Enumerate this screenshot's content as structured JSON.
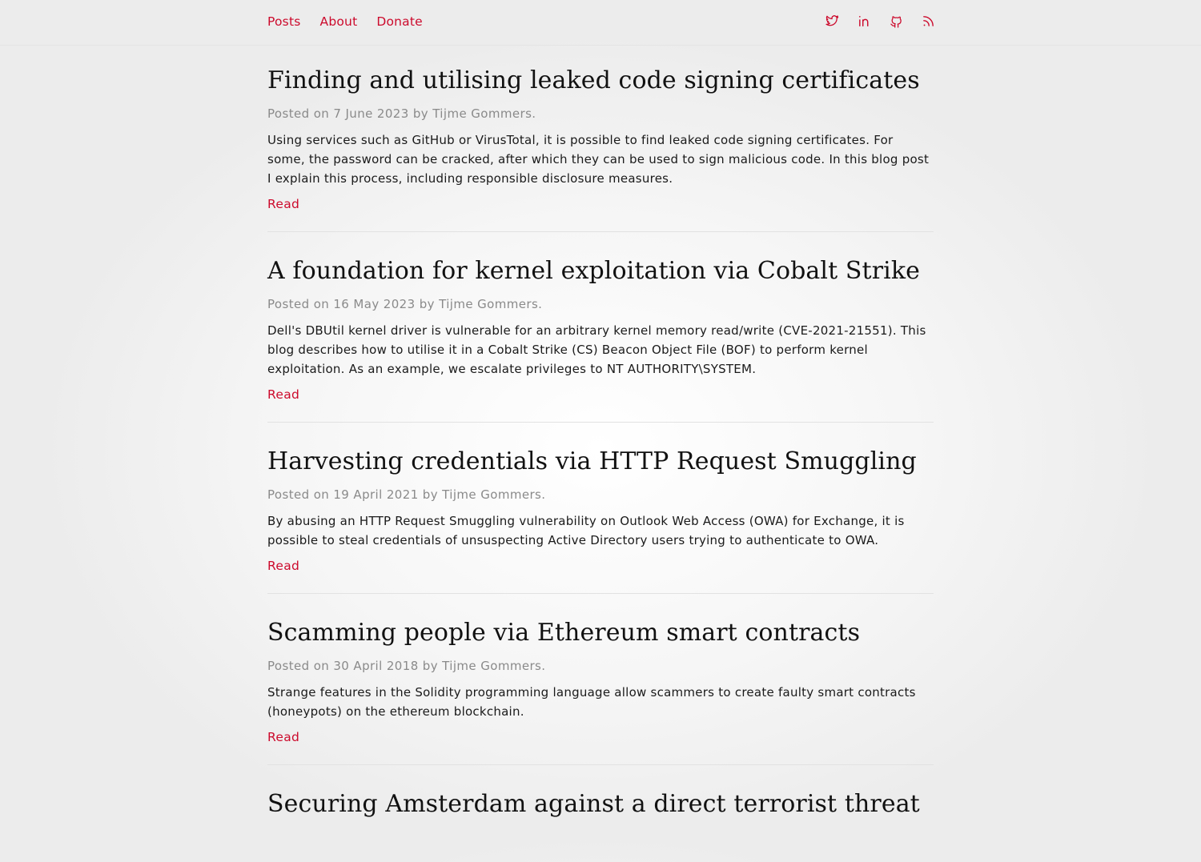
{
  "nav": {
    "items": [
      "Posts",
      "About",
      "Donate"
    ]
  },
  "social": {
    "icons": [
      "twitter-icon",
      "linkedin-icon",
      "github-icon",
      "rss-icon"
    ],
    "color": "#cc0a2c"
  },
  "accent_color": "#cc0a2c",
  "posts": [
    {
      "title": "Finding and utilising leaked code signing certificates",
      "meta": "Posted on 7 June 2023 by Tijme Gommers.",
      "excerpt": "Using services such as GitHub or VirusTotal, it is possible to find leaked code signing certificates. For some, the password can be cracked, after which they can be used to sign malicious code. In this blog post I explain this process, including responsible disclosure measures.",
      "read_label": "Read"
    },
    {
      "title": "A foundation for kernel exploitation via Cobalt Strike",
      "meta": "Posted on 16 May 2023 by Tijme Gommers.",
      "excerpt": "Dell's DBUtil kernel driver is vulnerable for an arbitrary kernel memory read/write (CVE-2021-21551). This blog describes how to utilise it in a Cobalt Strike (CS) Beacon Object File (BOF) to perform kernel exploitation. As an example, we escalate privileges to NT AUTHORITY\\SYSTEM.",
      "read_label": "Read"
    },
    {
      "title": "Harvesting credentials via HTTP Request Smuggling",
      "meta": "Posted on 19 April 2021 by Tijme Gommers.",
      "excerpt": "By abusing an HTTP Request Smuggling vulnerability on Outlook Web Access (OWA) for Exchange, it is possible to steal credentials of unsuspecting Active Directory users trying to authenticate to OWA.",
      "read_label": "Read"
    },
    {
      "title": "Scamming people via Ethereum smart contracts",
      "meta": "Posted on 30 April 2018 by Tijme Gommers.",
      "excerpt": "Strange features in the Solidity programming language allow scammers to create faulty smart contracts (honeypots) on the ethereum blockchain.",
      "read_label": "Read"
    },
    {
      "title": "Securing Amsterdam against a direct terrorist threat"
    }
  ]
}
